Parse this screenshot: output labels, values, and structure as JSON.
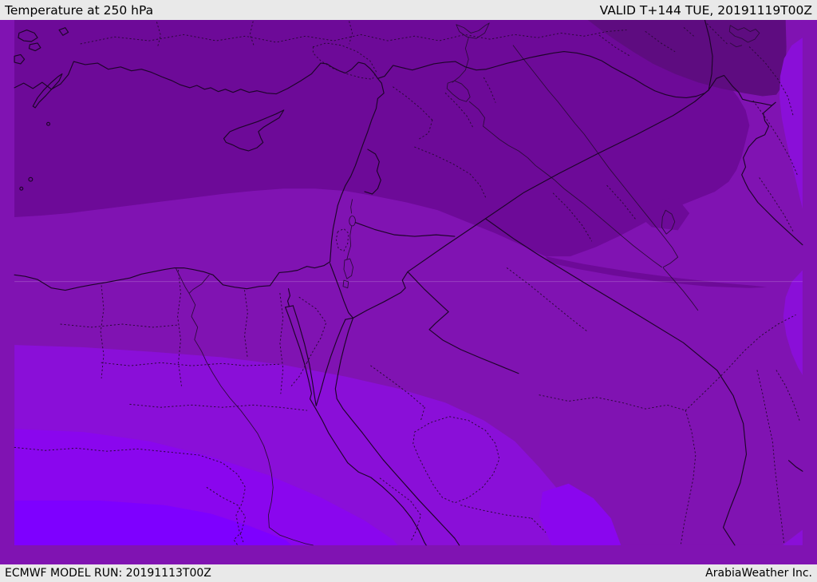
{
  "header": {
    "title": "Temperature at 250 hPa",
    "valid_label": "VALID T+144 TUE, 20191119T00Z"
  },
  "footer": {
    "model_run": "ECMWF MODEL RUN: 20191113T00Z",
    "credit": "ArabiaWeather Inc."
  },
  "map": {
    "type": "weather-temperature-map",
    "parameter": "Temperature",
    "level": "250 hPa",
    "region_shown": "Eastern Mediterranean / Middle East",
    "colors": {
      "bar_bg": "#e9e9e9",
      "bar_text": "#000000",
      "band_darkest": "#5e0c80",
      "band_dark": "#6d0a98",
      "band_medium": "#8013b2",
      "band_bright": "#8a0fd8",
      "band_brighter": "#8a06ee",
      "band_brightest": "#7e00ff",
      "coast_line": "#1d0429",
      "border_line": "#1d0429",
      "river_line": "#2b0a3a",
      "admin_dotted": "#2a0838",
      "latitude_hint": "rgba(255,255,255,0.16)"
    }
  }
}
